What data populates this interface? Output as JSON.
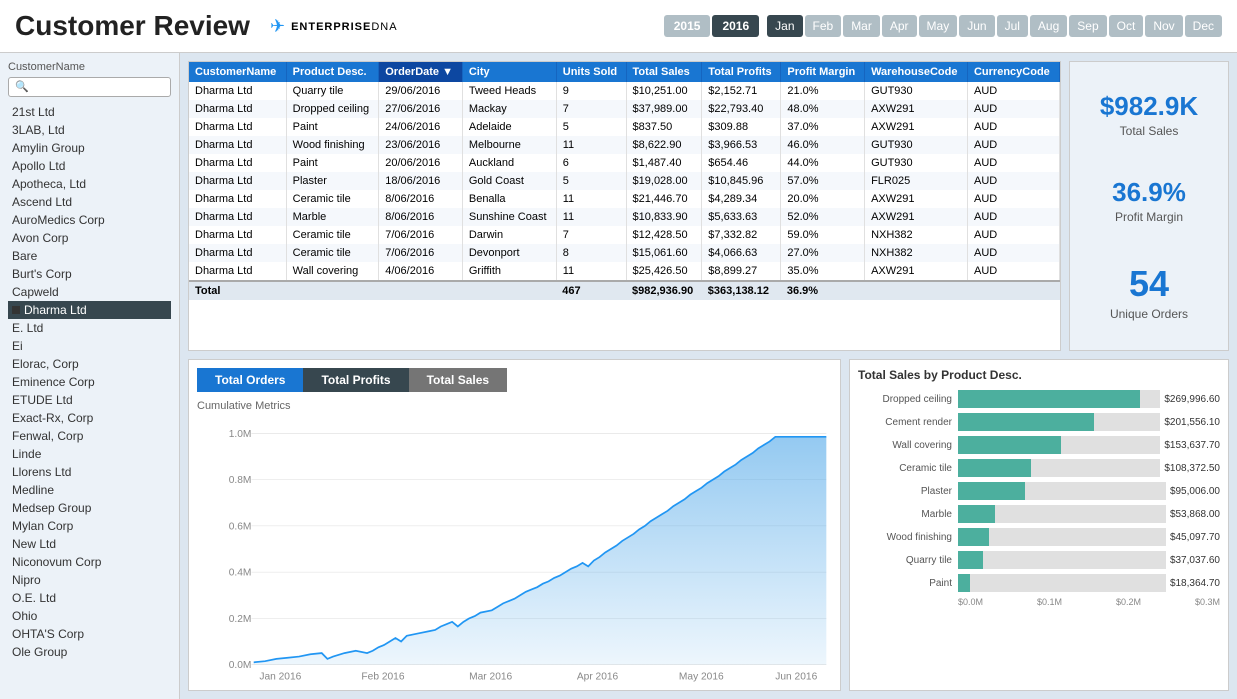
{
  "header": {
    "title": "Customer Review",
    "logo_icon": "✈",
    "logo_brand": "ENTERPRISE",
    "logo_sub": "DNA"
  },
  "years": [
    {
      "label": "2015",
      "active": false
    },
    {
      "label": "2016",
      "active": true
    }
  ],
  "months": [
    {
      "label": "Jan",
      "active": true
    },
    {
      "label": "Feb",
      "active": false
    },
    {
      "label": "Mar",
      "active": false
    },
    {
      "label": "Apr",
      "active": false
    },
    {
      "label": "May",
      "active": false
    },
    {
      "label": "Jun",
      "active": false
    },
    {
      "label": "Jul",
      "active": false
    },
    {
      "label": "Aug",
      "active": false
    },
    {
      "label": "Sep",
      "active": false
    },
    {
      "label": "Oct",
      "active": false
    },
    {
      "label": "Nov",
      "active": false
    },
    {
      "label": "Dec",
      "active": false
    }
  ],
  "sidebar": {
    "title": "CustomerName",
    "search_placeholder": "🔍",
    "items": [
      {
        "label": "21st Ltd",
        "selected": false
      },
      {
        "label": "3LAB, Ltd",
        "selected": false
      },
      {
        "label": "Amylin Group",
        "selected": false
      },
      {
        "label": "Apollo Ltd",
        "selected": false
      },
      {
        "label": "Apotheca, Ltd",
        "selected": false
      },
      {
        "label": "Ascend Ltd",
        "selected": false
      },
      {
        "label": "AuroMedics Corp",
        "selected": false
      },
      {
        "label": "Avon Corp",
        "selected": false
      },
      {
        "label": "Bare",
        "selected": false
      },
      {
        "label": "Burt's Corp",
        "selected": false
      },
      {
        "label": "Capweld",
        "selected": false
      },
      {
        "label": "Dharma Ltd",
        "selected": true,
        "dot": true
      },
      {
        "label": "E. Ltd",
        "selected": false
      },
      {
        "label": "Ei",
        "selected": false
      },
      {
        "label": "Elorac, Corp",
        "selected": false
      },
      {
        "label": "Eminence Corp",
        "selected": false
      },
      {
        "label": "ETUDE Ltd",
        "selected": false
      },
      {
        "label": "Exact-Rx, Corp",
        "selected": false
      },
      {
        "label": "Fenwal, Corp",
        "selected": false
      },
      {
        "label": "Linde",
        "selected": false
      },
      {
        "label": "Llorens Ltd",
        "selected": false
      },
      {
        "label": "Medline",
        "selected": false
      },
      {
        "label": "Medsep Group",
        "selected": false
      },
      {
        "label": "Mylan Corp",
        "selected": false
      },
      {
        "label": "New Ltd",
        "selected": false
      },
      {
        "label": "Niconovum Corp",
        "selected": false
      },
      {
        "label": "Nipro",
        "selected": false
      },
      {
        "label": "O.E. Ltd",
        "selected": false
      },
      {
        "label": "Ohio",
        "selected": false
      },
      {
        "label": "OHTA'S Corp",
        "selected": false
      },
      {
        "label": "Ole Group",
        "selected": false
      }
    ]
  },
  "table": {
    "columns": [
      "CustomerName",
      "Product Desc.",
      "OrderDate ▼",
      "City",
      "Units Sold",
      "Total Sales",
      "Total Profits",
      "Profit Margin",
      "WarehouseCode",
      "CurrencyCode"
    ],
    "rows": [
      [
        "Dharma Ltd",
        "Quarry tile",
        "29/06/2016",
        "Tweed Heads",
        "9",
        "$10,251.00",
        "$2,152.71",
        "21.0%",
        "GUT930",
        "AUD"
      ],
      [
        "Dharma Ltd",
        "Dropped ceiling",
        "27/06/2016",
        "Mackay",
        "7",
        "$37,989.00",
        "$22,793.40",
        "48.0%",
        "AXW291",
        "AUD"
      ],
      [
        "Dharma Ltd",
        "Paint",
        "24/06/2016",
        "Adelaide",
        "5",
        "$837.50",
        "$309.88",
        "37.0%",
        "AXW291",
        "AUD"
      ],
      [
        "Dharma Ltd",
        "Wood finishing",
        "23/06/2016",
        "Melbourne",
        "11",
        "$8,622.90",
        "$3,966.53",
        "46.0%",
        "GUT930",
        "AUD"
      ],
      [
        "Dharma Ltd",
        "Paint",
        "20/06/2016",
        "Auckland",
        "6",
        "$1,487.40",
        "$654.46",
        "44.0%",
        "GUT930",
        "AUD"
      ],
      [
        "Dharma Ltd",
        "Plaster",
        "18/06/2016",
        "Gold Coast",
        "5",
        "$19,028.00",
        "$10,845.96",
        "57.0%",
        "FLR025",
        "AUD"
      ],
      [
        "Dharma Ltd",
        "Ceramic tile",
        "8/06/2016",
        "Benalla",
        "11",
        "$21,446.70",
        "$4,289.34",
        "20.0%",
        "AXW291",
        "AUD"
      ],
      [
        "Dharma Ltd",
        "Marble",
        "8/06/2016",
        "Sunshine Coast",
        "11",
        "$10,833.90",
        "$5,633.63",
        "52.0%",
        "AXW291",
        "AUD"
      ],
      [
        "Dharma Ltd",
        "Ceramic tile",
        "7/06/2016",
        "Darwin",
        "7",
        "$12,428.50",
        "$7,332.82",
        "59.0%",
        "NXH382",
        "AUD"
      ],
      [
        "Dharma Ltd",
        "Ceramic tile",
        "7/06/2016",
        "Devonport",
        "8",
        "$15,061.60",
        "$4,066.63",
        "27.0%",
        "NXH382",
        "AUD"
      ],
      [
        "Dharma Ltd",
        "Wall covering",
        "4/06/2016",
        "Griffith",
        "11",
        "$25,426.50",
        "$8,899.27",
        "35.0%",
        "AXW291",
        "AUD"
      ]
    ],
    "footer": [
      "Total",
      "",
      "",
      "",
      "467",
      "$982,936.90",
      "$363,138.12",
      "36.9%",
      "",
      ""
    ]
  },
  "kpis": {
    "total_sales": "$982.9K",
    "total_sales_label": "Total Sales",
    "profit_margin": "36.9%",
    "profit_margin_label": "Profit Margin",
    "unique_orders": "54",
    "unique_orders_label": "Unique Orders"
  },
  "line_chart": {
    "tabs": [
      "Total Orders",
      "Total Profits",
      "Total Sales"
    ],
    "title": "Cumulative Metrics",
    "active_tab": 1,
    "x_labels": [
      "Jan 2016",
      "Feb 2016",
      "Mar 2016",
      "Apr 2016",
      "May 2016",
      "Jun 2016"
    ],
    "y_labels": [
      "0.0M",
      "0.2M",
      "0.4M",
      "0.6M",
      "0.8M",
      "1.0M"
    ]
  },
  "bar_chart": {
    "title": "Total Sales by Product Desc.",
    "bars": [
      {
        "label": "Dropped ceiling",
        "value": "$269,996.60",
        "pct": 90
      },
      {
        "label": "Cement render",
        "value": "$201,556.10",
        "pct": 67
      },
      {
        "label": "Wall covering",
        "value": "$153,637.70",
        "pct": 51
      },
      {
        "label": "Ceramic tile",
        "value": "$108,372.50",
        "pct": 36
      },
      {
        "label": "Plaster",
        "value": "$95,006.00",
        "pct": 32
      },
      {
        "label": "Marble",
        "value": "$53,868.00",
        "pct": 18
      },
      {
        "label": "Wood finishing",
        "value": "$45,097.70",
        "pct": 15
      },
      {
        "label": "Quarry tile",
        "value": "$37,037.60",
        "pct": 12
      },
      {
        "label": "Paint",
        "value": "$18,364.70",
        "pct": 6
      }
    ],
    "x_axis": [
      "$0.0M",
      "$0.1M",
      "$0.2M",
      "$0.3M"
    ]
  }
}
